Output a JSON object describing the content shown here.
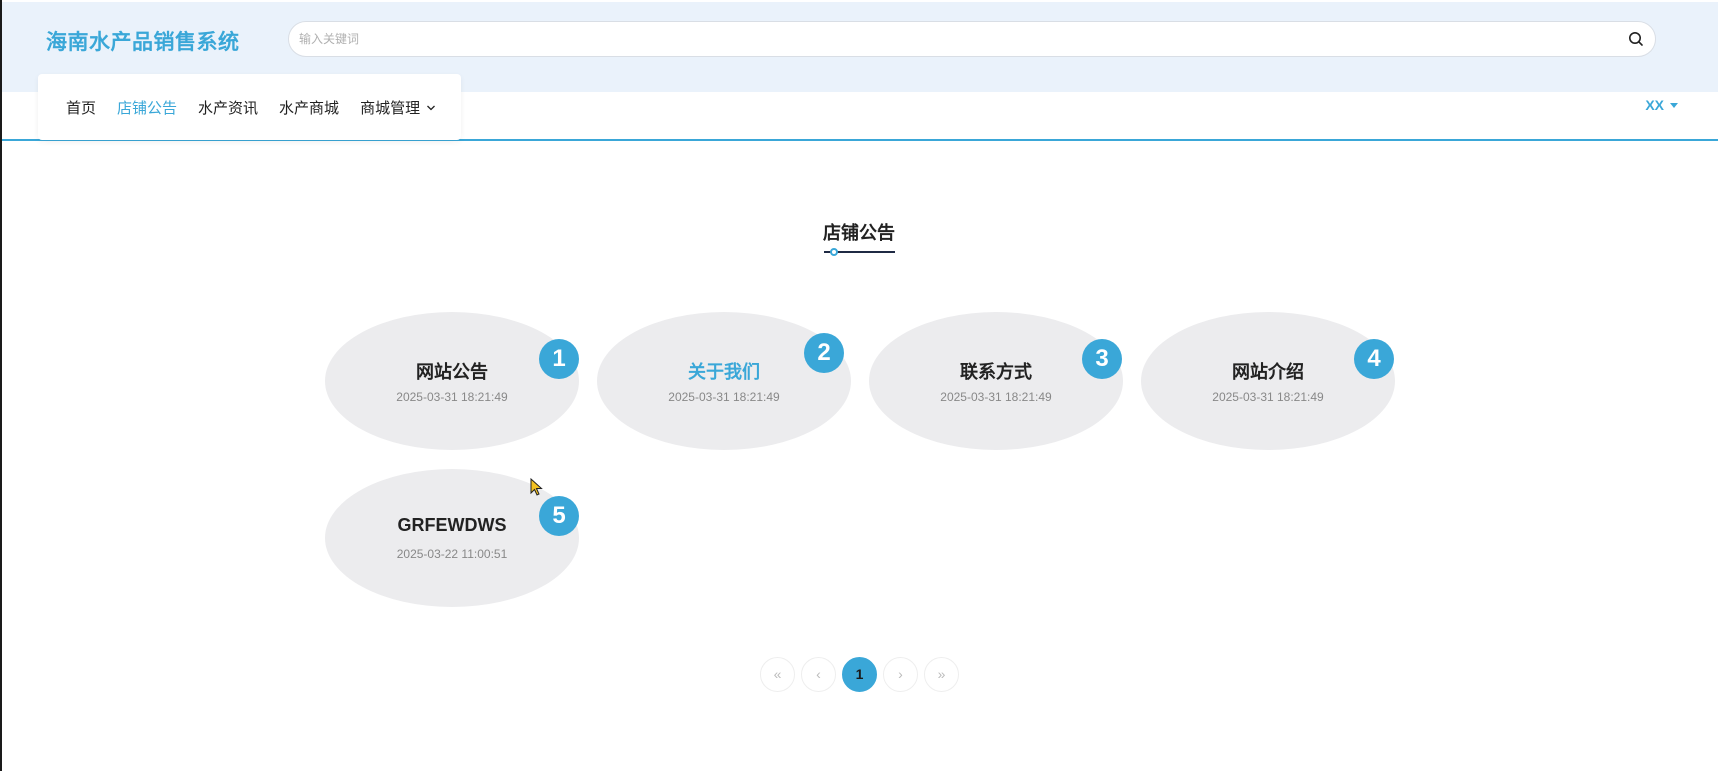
{
  "header": {
    "brand": "海南水产品销售系统",
    "search_placeholder": "输入关键词"
  },
  "nav": {
    "items": [
      {
        "label": "首页",
        "active": false
      },
      {
        "label": "店铺公告",
        "active": true
      },
      {
        "label": "水产资讯",
        "active": false
      },
      {
        "label": "水产商城",
        "active": false
      },
      {
        "label": "商城管理",
        "active": false,
        "has_dropdown": true
      }
    ],
    "user": "XX"
  },
  "section": {
    "title": "店铺公告"
  },
  "announcements": [
    {
      "number": "1",
      "title": "网站公告",
      "date": "2025-03-31 18:21:49"
    },
    {
      "number": "2",
      "title": "关于我们",
      "date": "2025-03-31 18:21:49"
    },
    {
      "number": "3",
      "title": "联系方式",
      "date": "2025-03-31 18:21:49"
    },
    {
      "number": "4",
      "title": "网站介绍",
      "date": "2025-03-31 18:21:49"
    },
    {
      "number": "5",
      "title": "GRFEWDWS",
      "date": "2025-03-22 11:00:51"
    }
  ],
  "pagination": {
    "first": "«",
    "prev": "‹",
    "current": "1",
    "next": "›",
    "last": "»"
  },
  "colors": {
    "accent": "#3aa7d8",
    "header_bg": "#eaf2fb",
    "card_bg": "#ececee"
  }
}
